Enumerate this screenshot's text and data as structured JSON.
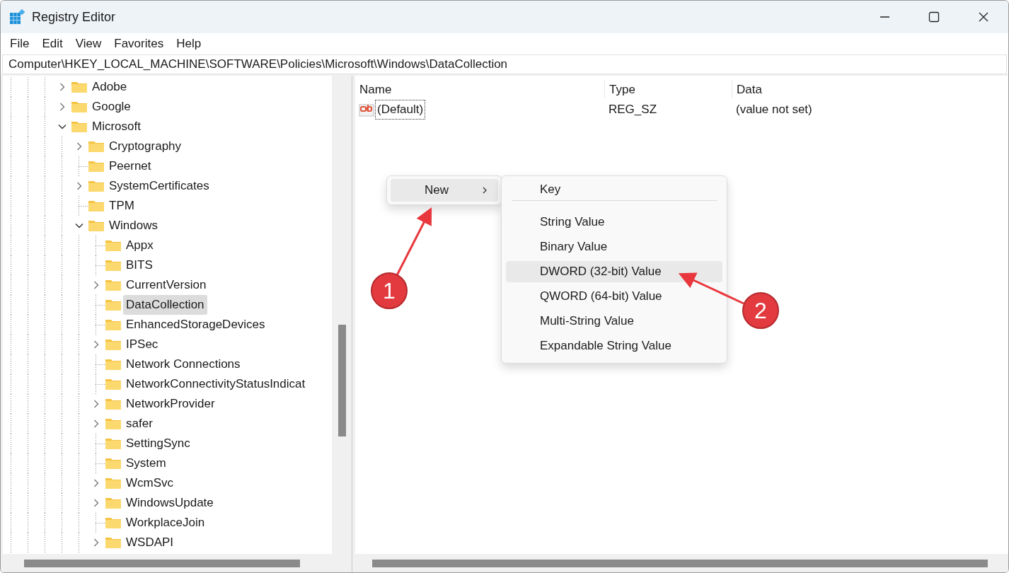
{
  "window": {
    "title": "Registry Editor"
  },
  "menu": [
    "File",
    "Edit",
    "View",
    "Favorites",
    "Help"
  ],
  "address": "Computer\\HKEY_LOCAL_MACHINE\\SOFTWARE\\Policies\\Microsoft\\Windows\\DataCollection",
  "tree": [
    {
      "label": "Adobe",
      "kind": "branch",
      "expanded": false,
      "selected": false
    },
    {
      "label": "Google",
      "kind": "branch",
      "expanded": false,
      "selected": false
    },
    {
      "label": "Microsoft",
      "kind": "branch",
      "expanded": true,
      "selected": false,
      "children": [
        {
          "label": "Cryptography",
          "kind": "branch",
          "expanded": false,
          "selected": false
        },
        {
          "label": "Peernet",
          "kind": "leaf",
          "selected": false
        },
        {
          "label": "SystemCertificates",
          "kind": "branch",
          "expanded": false,
          "selected": false
        },
        {
          "label": "TPM",
          "kind": "leaf",
          "selected": false
        },
        {
          "label": "Windows",
          "kind": "branch",
          "expanded": true,
          "selected": false,
          "children": [
            {
              "label": "Appx",
              "kind": "leaf",
              "selected": false
            },
            {
              "label": "BITS",
              "kind": "leaf",
              "selected": false
            },
            {
              "label": "CurrentVersion",
              "kind": "branch",
              "expanded": false,
              "selected": false
            },
            {
              "label": "DataCollection",
              "kind": "leaf",
              "selected": true
            },
            {
              "label": "EnhancedStorageDevices",
              "kind": "leaf",
              "selected": false
            },
            {
              "label": "IPSec",
              "kind": "branch",
              "expanded": false,
              "selected": false
            },
            {
              "label": "Network Connections",
              "kind": "leaf",
              "selected": false
            },
            {
              "label": "NetworkConnectivityStatusIndicat",
              "kind": "leaf",
              "selected": false
            },
            {
              "label": "NetworkProvider",
              "kind": "branch",
              "expanded": false,
              "selected": false
            },
            {
              "label": "safer",
              "kind": "branch",
              "expanded": false,
              "selected": false
            },
            {
              "label": "SettingSync",
              "kind": "leaf",
              "selected": false
            },
            {
              "label": "System",
              "kind": "leaf",
              "selected": false
            },
            {
              "label": "WcmSvc",
              "kind": "branch",
              "expanded": false,
              "selected": false
            },
            {
              "label": "WindowsUpdate",
              "kind": "branch",
              "expanded": false,
              "selected": false
            },
            {
              "label": "WorkplaceJoin",
              "kind": "leaf",
              "selected": false
            },
            {
              "label": "WSDAPI",
              "kind": "branch",
              "expanded": false,
              "selected": false
            }
          ]
        }
      ]
    }
  ],
  "values": {
    "columns": [
      "Name",
      "Type",
      "Data"
    ],
    "rows": [
      {
        "name": "(Default)",
        "type": "REG_SZ",
        "data": "(value not set)"
      }
    ]
  },
  "context_menu": {
    "items": [
      {
        "label": "New",
        "selected": true
      }
    ],
    "submenu": [
      {
        "label": "Key",
        "selected": false,
        "separator_after": true
      },
      {
        "label": "String Value",
        "selected": false,
        "separator_after": false
      },
      {
        "label": "Binary Value",
        "selected": false,
        "separator_after": false
      },
      {
        "label": "DWORD (32-bit) Value",
        "selected": true,
        "separator_after": false
      },
      {
        "label": "QWORD (64-bit) Value",
        "selected": false,
        "separator_after": false
      },
      {
        "label": "Multi-String Value",
        "selected": false,
        "separator_after": false
      },
      {
        "label": "Expandable String Value",
        "selected": false,
        "separator_after": false
      }
    ]
  },
  "annotations": [
    {
      "number": "1"
    },
    {
      "number": "2"
    }
  ]
}
